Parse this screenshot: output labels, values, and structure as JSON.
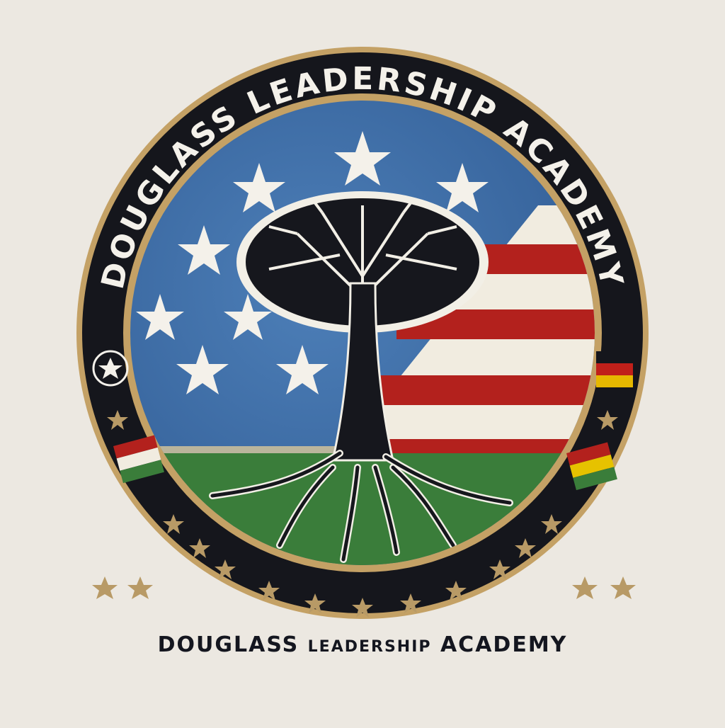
{
  "emblem": {
    "ring_text": "DOUGLASS LEADERSHIP ACADEMY",
    "ring_color": "#15161c",
    "gold": "#c4a165",
    "sky": "#3f6fa8",
    "green": "#3a7d3a",
    "stripe_red": "#b3211d",
    "stripe_white": "#f1ece0",
    "icons": [
      "star-icon",
      "tree-icon",
      "flag-icon"
    ]
  },
  "caption": {
    "first": "DOUGLASS",
    "middle": "LEADERSHIP",
    "last": "ACADEMY"
  }
}
